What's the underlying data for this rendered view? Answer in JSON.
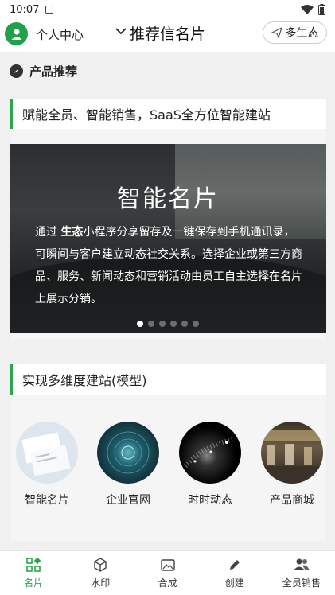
{
  "status_bar": {
    "time": "10:07"
  },
  "header": {
    "profile_label": "个人中心",
    "title": "推荐信名片",
    "eco_button": "多生态"
  },
  "section": {
    "title": "产品推荐"
  },
  "card1": {
    "title": "赋能全员、智能销售，SaaS全方位智能建站",
    "banner": {
      "title": "智能名片",
      "text_prefix": "通过 ",
      "text_bold": "生态",
      "text_rest": "小程序分享留存及一键保存到手机通讯录，可瞬间与客户建立动态社交关系。选择企业或第三方商品、服务、新闻动态和营销活动由员工自主选择在名片上展示分销。"
    },
    "dots_count": 6,
    "active_dot": 0
  },
  "card2": {
    "title": "实现多维度建站(模型)",
    "models": [
      {
        "label": "智能名片"
      },
      {
        "label": "企业官网"
      },
      {
        "label": "时时动态"
      },
      {
        "label": "产品商城"
      }
    ]
  },
  "bottom_nav": [
    {
      "label": "名片",
      "icon": "card-grid-icon",
      "active": true
    },
    {
      "label": "水印",
      "icon": "cube-icon",
      "active": false
    },
    {
      "label": "合成",
      "icon": "image-icon",
      "active": false
    },
    {
      "label": "创建",
      "icon": "pen-icon",
      "active": false
    },
    {
      "label": "全员销售",
      "icon": "people-icon",
      "active": false
    }
  ],
  "colors": {
    "accent": "#2fa44f",
    "avatar": "#20a04a"
  }
}
